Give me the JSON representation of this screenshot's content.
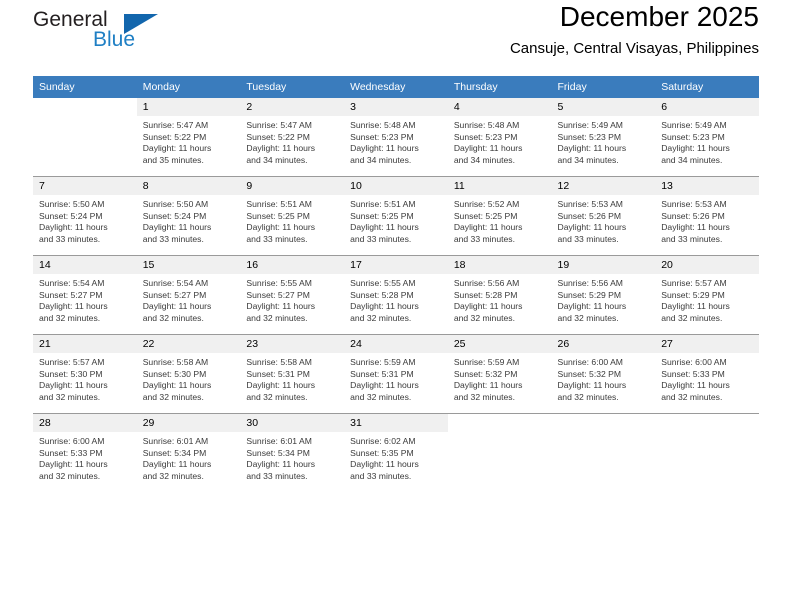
{
  "brand": {
    "name_part1": "General",
    "name_part2": "Blue",
    "triangle_color": "#1266ad",
    "blue_color": "#1f7fc4"
  },
  "header": {
    "title": "December 2025",
    "subtitle": "Cansuje, Central Visayas, Philippines"
  },
  "calendar": {
    "header_bg": "#3a7cbd",
    "daynum_bg": "#f0f0f0",
    "weekday_headers": [
      "Sunday",
      "Monday",
      "Tuesday",
      "Wednesday",
      "Thursday",
      "Friday",
      "Saturday"
    ],
    "weeks": [
      [
        {
          "day": "",
          "blank": true,
          "sunrise": "",
          "sunset": "",
          "daylight_line1": "",
          "daylight_line2": ""
        },
        {
          "day": "1",
          "blank": false,
          "sunrise": "Sunrise: 5:47 AM",
          "sunset": "Sunset: 5:22 PM",
          "daylight_line1": "Daylight: 11 hours",
          "daylight_line2": "and 35 minutes."
        },
        {
          "day": "2",
          "blank": false,
          "sunrise": "Sunrise: 5:47 AM",
          "sunset": "Sunset: 5:22 PM",
          "daylight_line1": "Daylight: 11 hours",
          "daylight_line2": "and 34 minutes."
        },
        {
          "day": "3",
          "blank": false,
          "sunrise": "Sunrise: 5:48 AM",
          "sunset": "Sunset: 5:23 PM",
          "daylight_line1": "Daylight: 11 hours",
          "daylight_line2": "and 34 minutes."
        },
        {
          "day": "4",
          "blank": false,
          "sunrise": "Sunrise: 5:48 AM",
          "sunset": "Sunset: 5:23 PM",
          "daylight_line1": "Daylight: 11 hours",
          "daylight_line2": "and 34 minutes."
        },
        {
          "day": "5",
          "blank": false,
          "sunrise": "Sunrise: 5:49 AM",
          "sunset": "Sunset: 5:23 PM",
          "daylight_line1": "Daylight: 11 hours",
          "daylight_line2": "and 34 minutes."
        },
        {
          "day": "6",
          "blank": false,
          "sunrise": "Sunrise: 5:49 AM",
          "sunset": "Sunset: 5:23 PM",
          "daylight_line1": "Daylight: 11 hours",
          "daylight_line2": "and 34 minutes."
        }
      ],
      [
        {
          "day": "7",
          "blank": false,
          "sunrise": "Sunrise: 5:50 AM",
          "sunset": "Sunset: 5:24 PM",
          "daylight_line1": "Daylight: 11 hours",
          "daylight_line2": "and 33 minutes."
        },
        {
          "day": "8",
          "blank": false,
          "sunrise": "Sunrise: 5:50 AM",
          "sunset": "Sunset: 5:24 PM",
          "daylight_line1": "Daylight: 11 hours",
          "daylight_line2": "and 33 minutes."
        },
        {
          "day": "9",
          "blank": false,
          "sunrise": "Sunrise: 5:51 AM",
          "sunset": "Sunset: 5:25 PM",
          "daylight_line1": "Daylight: 11 hours",
          "daylight_line2": "and 33 minutes."
        },
        {
          "day": "10",
          "blank": false,
          "sunrise": "Sunrise: 5:51 AM",
          "sunset": "Sunset: 5:25 PM",
          "daylight_line1": "Daylight: 11 hours",
          "daylight_line2": "and 33 minutes."
        },
        {
          "day": "11",
          "blank": false,
          "sunrise": "Sunrise: 5:52 AM",
          "sunset": "Sunset: 5:25 PM",
          "daylight_line1": "Daylight: 11 hours",
          "daylight_line2": "and 33 minutes."
        },
        {
          "day": "12",
          "blank": false,
          "sunrise": "Sunrise: 5:53 AM",
          "sunset": "Sunset: 5:26 PM",
          "daylight_line1": "Daylight: 11 hours",
          "daylight_line2": "and 33 minutes."
        },
        {
          "day": "13",
          "blank": false,
          "sunrise": "Sunrise: 5:53 AM",
          "sunset": "Sunset: 5:26 PM",
          "daylight_line1": "Daylight: 11 hours",
          "daylight_line2": "and 33 minutes."
        }
      ],
      [
        {
          "day": "14",
          "blank": false,
          "sunrise": "Sunrise: 5:54 AM",
          "sunset": "Sunset: 5:27 PM",
          "daylight_line1": "Daylight: 11 hours",
          "daylight_line2": "and 32 minutes."
        },
        {
          "day": "15",
          "blank": false,
          "sunrise": "Sunrise: 5:54 AM",
          "sunset": "Sunset: 5:27 PM",
          "daylight_line1": "Daylight: 11 hours",
          "daylight_line2": "and 32 minutes."
        },
        {
          "day": "16",
          "blank": false,
          "sunrise": "Sunrise: 5:55 AM",
          "sunset": "Sunset: 5:27 PM",
          "daylight_line1": "Daylight: 11 hours",
          "daylight_line2": "and 32 minutes."
        },
        {
          "day": "17",
          "blank": false,
          "sunrise": "Sunrise: 5:55 AM",
          "sunset": "Sunset: 5:28 PM",
          "daylight_line1": "Daylight: 11 hours",
          "daylight_line2": "and 32 minutes."
        },
        {
          "day": "18",
          "blank": false,
          "sunrise": "Sunrise: 5:56 AM",
          "sunset": "Sunset: 5:28 PM",
          "daylight_line1": "Daylight: 11 hours",
          "daylight_line2": "and 32 minutes."
        },
        {
          "day": "19",
          "blank": false,
          "sunrise": "Sunrise: 5:56 AM",
          "sunset": "Sunset: 5:29 PM",
          "daylight_line1": "Daylight: 11 hours",
          "daylight_line2": "and 32 minutes."
        },
        {
          "day": "20",
          "blank": false,
          "sunrise": "Sunrise: 5:57 AM",
          "sunset": "Sunset: 5:29 PM",
          "daylight_line1": "Daylight: 11 hours",
          "daylight_line2": "and 32 minutes."
        }
      ],
      [
        {
          "day": "21",
          "blank": false,
          "sunrise": "Sunrise: 5:57 AM",
          "sunset": "Sunset: 5:30 PM",
          "daylight_line1": "Daylight: 11 hours",
          "daylight_line2": "and 32 minutes."
        },
        {
          "day": "22",
          "blank": false,
          "sunrise": "Sunrise: 5:58 AM",
          "sunset": "Sunset: 5:30 PM",
          "daylight_line1": "Daylight: 11 hours",
          "daylight_line2": "and 32 minutes."
        },
        {
          "day": "23",
          "blank": false,
          "sunrise": "Sunrise: 5:58 AM",
          "sunset": "Sunset: 5:31 PM",
          "daylight_line1": "Daylight: 11 hours",
          "daylight_line2": "and 32 minutes."
        },
        {
          "day": "24",
          "blank": false,
          "sunrise": "Sunrise: 5:59 AM",
          "sunset": "Sunset: 5:31 PM",
          "daylight_line1": "Daylight: 11 hours",
          "daylight_line2": "and 32 minutes."
        },
        {
          "day": "25",
          "blank": false,
          "sunrise": "Sunrise: 5:59 AM",
          "sunset": "Sunset: 5:32 PM",
          "daylight_line1": "Daylight: 11 hours",
          "daylight_line2": "and 32 minutes."
        },
        {
          "day": "26",
          "blank": false,
          "sunrise": "Sunrise: 6:00 AM",
          "sunset": "Sunset: 5:32 PM",
          "daylight_line1": "Daylight: 11 hours",
          "daylight_line2": "and 32 minutes."
        },
        {
          "day": "27",
          "blank": false,
          "sunrise": "Sunrise: 6:00 AM",
          "sunset": "Sunset: 5:33 PM",
          "daylight_line1": "Daylight: 11 hours",
          "daylight_line2": "and 32 minutes."
        }
      ],
      [
        {
          "day": "28",
          "blank": false,
          "sunrise": "Sunrise: 6:00 AM",
          "sunset": "Sunset: 5:33 PM",
          "daylight_line1": "Daylight: 11 hours",
          "daylight_line2": "and 32 minutes."
        },
        {
          "day": "29",
          "blank": false,
          "sunrise": "Sunrise: 6:01 AM",
          "sunset": "Sunset: 5:34 PM",
          "daylight_line1": "Daylight: 11 hours",
          "daylight_line2": "and 32 minutes."
        },
        {
          "day": "30",
          "blank": false,
          "sunrise": "Sunrise: 6:01 AM",
          "sunset": "Sunset: 5:34 PM",
          "daylight_line1": "Daylight: 11 hours",
          "daylight_line2": "and 33 minutes."
        },
        {
          "day": "31",
          "blank": false,
          "sunrise": "Sunrise: 6:02 AM",
          "sunset": "Sunset: 5:35 PM",
          "daylight_line1": "Daylight: 11 hours",
          "daylight_line2": "and 33 minutes."
        },
        {
          "day": "",
          "blank": true,
          "sunrise": "",
          "sunset": "",
          "daylight_line1": "",
          "daylight_line2": ""
        },
        {
          "day": "",
          "blank": true,
          "sunrise": "",
          "sunset": "",
          "daylight_line1": "",
          "daylight_line2": ""
        },
        {
          "day": "",
          "blank": true,
          "sunrise": "",
          "sunset": "",
          "daylight_line1": "",
          "daylight_line2": ""
        }
      ]
    ]
  }
}
